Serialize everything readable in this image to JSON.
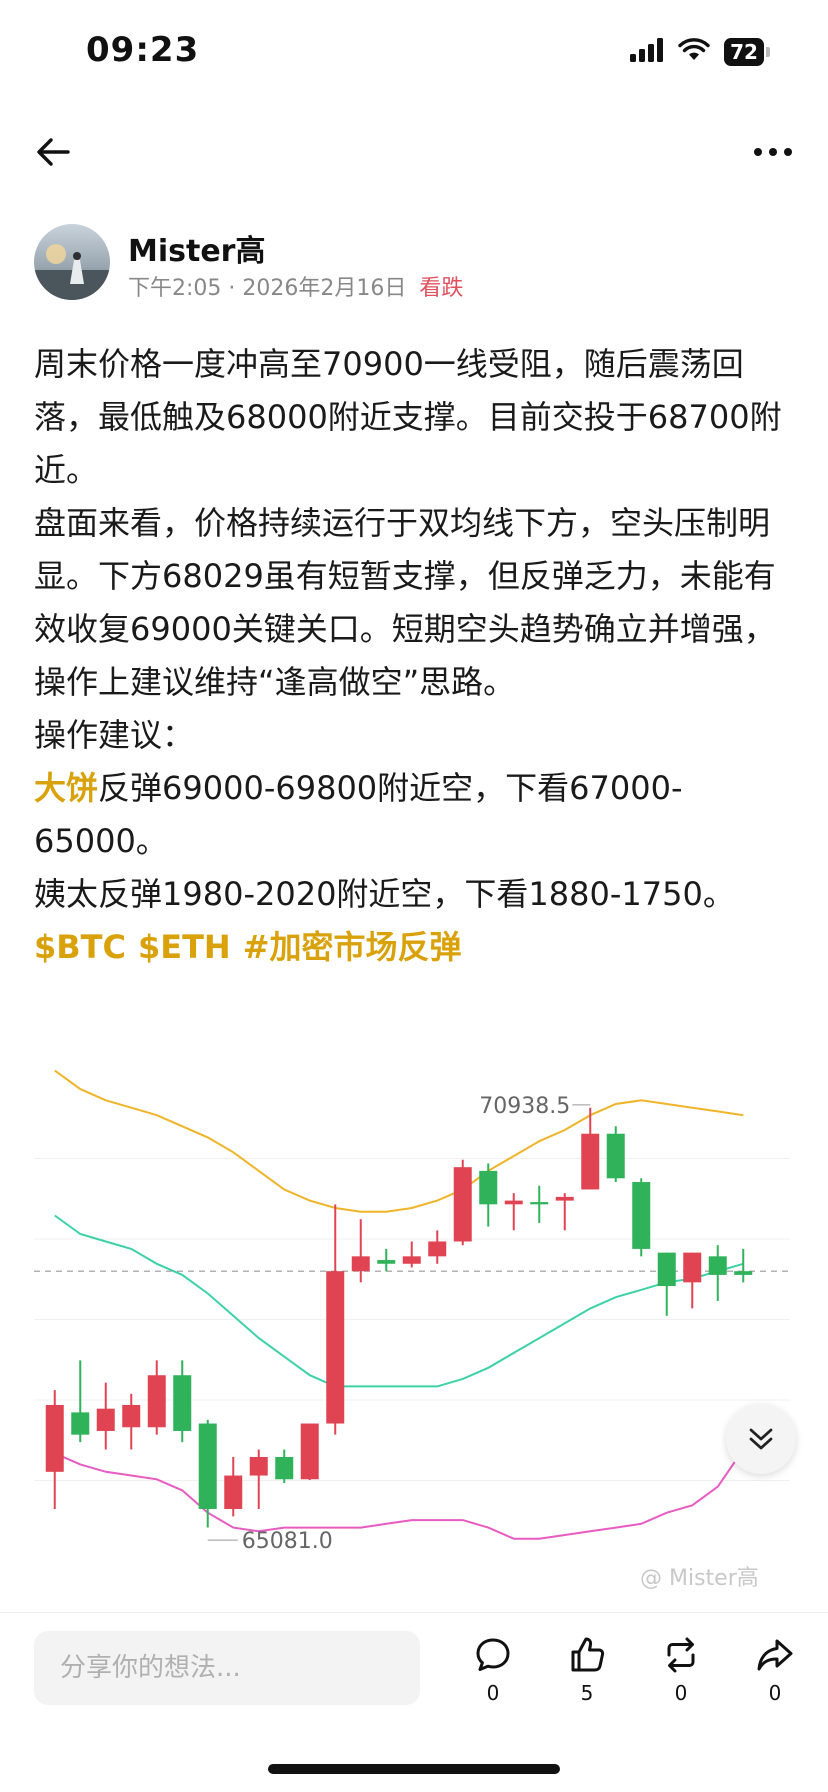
{
  "status_bar": {
    "time": "09:23",
    "battery": "72"
  },
  "author": {
    "name": "Mister高",
    "time": "下午2:05",
    "separator": "·",
    "date": "2026年2月16日",
    "sentiment": "看跌"
  },
  "post": {
    "p1": "周末价格一度冲高至70900一线受阻，随后震荡回落，最低触及68000附近支撑。目前交投于68700附近。",
    "p2": "盘面来看，价格持续运行于双均线下方，空头压制明显。下方68029虽有短暂支撑，但反弹乏力，未能有效收复69000关键关口。短期空头趋势确立并增强，操作上建议维持“逢高做空”思路。",
    "p3": "操作建议：",
    "p4_highlight": "大饼",
    "p4_rest": "反弹69000-69800附近空，下看67000-65000。",
    "p5": "姨太反弹1980-2020附近空，下看1880-1750。",
    "tags": [
      "$BTC",
      "$ETH",
      "#加密市场反弹"
    ]
  },
  "chart": {
    "high_label": "70938.5",
    "low_label": "65081.0",
    "watermark": "@ Mister高",
    "colors": {
      "up": "#e04352",
      "down": "#2fb25a",
      "upper_band": "#f0b429",
      "mid_band": "#3ed1a8",
      "lower_band": "#e85bc1"
    }
  },
  "chart_data": {
    "type": "candlestick",
    "ylim": [
      64800,
      71300
    ],
    "price_line": 68700,
    "high_marker": 70938.5,
    "low_marker": 65081.0,
    "candles": [
      {
        "o": 66000,
        "h": 67100,
        "l": 65500,
        "c": 66900
      },
      {
        "o": 66800,
        "h": 67500,
        "l": 66400,
        "c": 66500
      },
      {
        "o": 66550,
        "h": 67200,
        "l": 66300,
        "c": 66850
      },
      {
        "o": 66600,
        "h": 67050,
        "l": 66300,
        "c": 66900
      },
      {
        "o": 66600,
        "h": 67500,
        "l": 66500,
        "c": 67300
      },
      {
        "o": 67300,
        "h": 67500,
        "l": 66400,
        "c": 66550
      },
      {
        "o": 66650,
        "h": 66700,
        "l": 65250,
        "c": 65500
      },
      {
        "o": 65500,
        "h": 66200,
        "l": 65400,
        "c": 65950
      },
      {
        "o": 65950,
        "h": 66300,
        "l": 65500,
        "c": 66200
      },
      {
        "o": 66200,
        "h": 66300,
        "l": 65850,
        "c": 65900
      },
      {
        "o": 65900,
        "h": 66650,
        "l": 65890,
        "c": 66650
      },
      {
        "o": 66650,
        "h": 69600,
        "l": 66500,
        "c": 68700
      },
      {
        "o": 68700,
        "h": 69400,
        "l": 68550,
        "c": 68900
      },
      {
        "o": 68850,
        "h": 69000,
        "l": 68700,
        "c": 68800
      },
      {
        "o": 68800,
        "h": 69100,
        "l": 68750,
        "c": 68900
      },
      {
        "o": 68900,
        "h": 69250,
        "l": 68800,
        "c": 69100
      },
      {
        "o": 69100,
        "h": 70200,
        "l": 69050,
        "c": 70100
      },
      {
        "o": 70050,
        "h": 70150,
        "l": 69300,
        "c": 69600
      },
      {
        "o": 69600,
        "h": 69750,
        "l": 69250,
        "c": 69650
      },
      {
        "o": 69630,
        "h": 69850,
        "l": 69350,
        "c": 69600
      },
      {
        "o": 69650,
        "h": 69750,
        "l": 69250,
        "c": 69700
      },
      {
        "o": 69800,
        "h": 70900,
        "l": 69800,
        "c": 70550
      },
      {
        "o": 70550,
        "h": 70650,
        "l": 69900,
        "c": 69950
      },
      {
        "o": 69900,
        "h": 69950,
        "l": 68900,
        "c": 69000
      },
      {
        "o": 68950,
        "h": 68950,
        "l": 68100,
        "c": 68500
      },
      {
        "o": 68550,
        "h": 68950,
        "l": 68200,
        "c": 68950
      },
      {
        "o": 68900,
        "h": 69050,
        "l": 68300,
        "c": 68650
      },
      {
        "o": 68700,
        "h": 69000,
        "l": 68550,
        "c": 68650
      }
    ],
    "upper_band": [
      71400,
      71150,
      71000,
      70900,
      70800,
      70650,
      70500,
      70300,
      70050,
      69800,
      69650,
      69550,
      69500,
      69500,
      69550,
      69650,
      69800,
      70050,
      70250,
      70450,
      70600,
      70800,
      70950,
      71000,
      70950,
      70900,
      70850,
      70800
    ],
    "mid_band": [
      69450,
      69200,
      69100,
      69000,
      68800,
      68650,
      68400,
      68100,
      67800,
      67550,
      67300,
      67150,
      67150,
      67150,
      67150,
      67150,
      67250,
      67400,
      67600,
      67800,
      68000,
      68200,
      68350,
      68450,
      68550,
      68600,
      68700,
      68800
    ],
    "lower_band": [
      66250,
      66100,
      66000,
      65950,
      65900,
      65750,
      65450,
      65250,
      65200,
      65250,
      65250,
      65250,
      65250,
      65300,
      65350,
      65350,
      65350,
      65250,
      65100,
      65100,
      65150,
      65200,
      65250,
      65300,
      65450,
      65550,
      65800,
      66300
    ]
  },
  "actions": {
    "comment_placeholder": "分享你的想法...",
    "comments": "0",
    "likes": "5",
    "reposts": "0",
    "shares": "0"
  }
}
